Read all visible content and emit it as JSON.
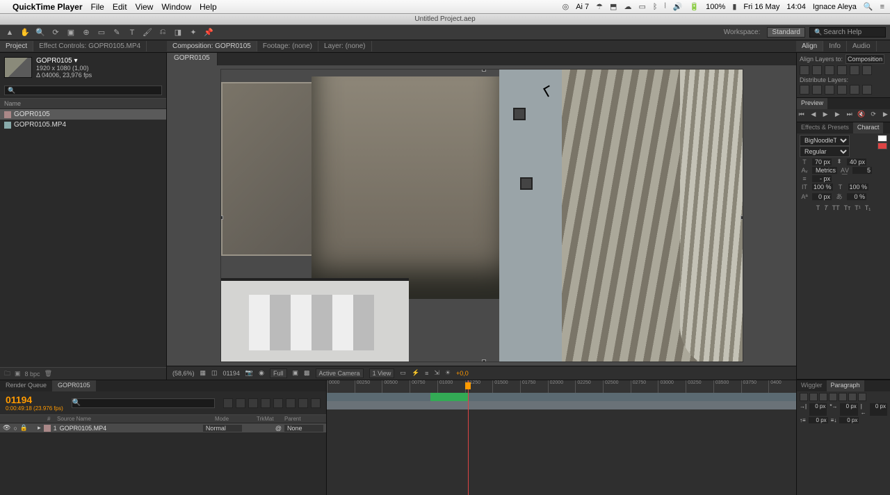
{
  "menubar": {
    "app": "QuickTime Player",
    "items": [
      "File",
      "Edit",
      "View",
      "Window",
      "Help"
    ],
    "status_battery": "100%",
    "status_date": "Fri 16 May",
    "status_time": "14:04",
    "status_user": "Ignace Aleya",
    "adobe_badge": "Ai 7"
  },
  "titlebar": "Untitled Project.aep",
  "project": {
    "tab": "Project",
    "effect_tab": "Effect Controls: GOPR0105.MP4",
    "name": "GOPR0105 ▾",
    "dims": "1920 x 1080 (1,00)",
    "dur": "Δ 04006, 23,976 fps",
    "col_name": "Name",
    "items": [
      {
        "label": "GOPR0105",
        "type": "comp"
      },
      {
        "label": "GOPR0105.MP4",
        "type": "video"
      }
    ],
    "bpc": "8 bpc"
  },
  "comp_panel": {
    "label": "Composition: GOPR0105",
    "footage_label": "Footage: (none)",
    "layer_label": "Layer: (none)",
    "tab": "GOPR0105"
  },
  "viewer_footer": {
    "zoom": "(58,6%)",
    "frame": "01194",
    "res": "Full",
    "camera": "Active Camera",
    "view": "1 View",
    "exposure": "+0,0"
  },
  "workspace": {
    "label": "Workspace:",
    "value": "Standard"
  },
  "search_placeholder": "Search Help",
  "align": {
    "tab_align": "Align",
    "tab_info": "Info",
    "tab_audio": "Audio",
    "layers_to": "Align Layers to:",
    "target": "Composition",
    "dist": "Distribute Layers:"
  },
  "preview": {
    "tab": "Preview"
  },
  "effects_tab": "Effects & Presets",
  "char": {
    "tab": "Charact",
    "font": "BigNoodleTitling",
    "style": "Regular",
    "size": "70 px",
    "leading": "40 px",
    "kerning": "Metrics",
    "tracking": "5",
    "stroke": "- px",
    "vscale": "100 %",
    "hscale": "100 %",
    "baseline": "0 px",
    "tsume": "0 %"
  },
  "timeline": {
    "tab_render": "Render Queue",
    "tab_comp": "GOPR0105",
    "frame": "01194",
    "tc": "0:00:49:18 (23.976 fps)",
    "cols": {
      "source": "Source Name",
      "mode": "Mode",
      "trk": "TrkMat",
      "parent": "Parent"
    },
    "layer": {
      "num": "1",
      "name": "GOPR0105.MP4",
      "mode": "Normal",
      "parent": "None"
    },
    "ticks": [
      "0000",
      "00250",
      "00500",
      "00750",
      "01000",
      "01250",
      "01500",
      "01750",
      "02000",
      "02250",
      "02500",
      "02750",
      "03000",
      "03250",
      "03500",
      "03750",
      "0400"
    ]
  },
  "paragraph": {
    "tab_wiggler": "Wiggler",
    "tab_para": "Paragraph",
    "indent_l": "0 px",
    "indent_r": "0 px",
    "indent_f": "0 px",
    "space_b": "0 px",
    "space_a": "0 px"
  }
}
